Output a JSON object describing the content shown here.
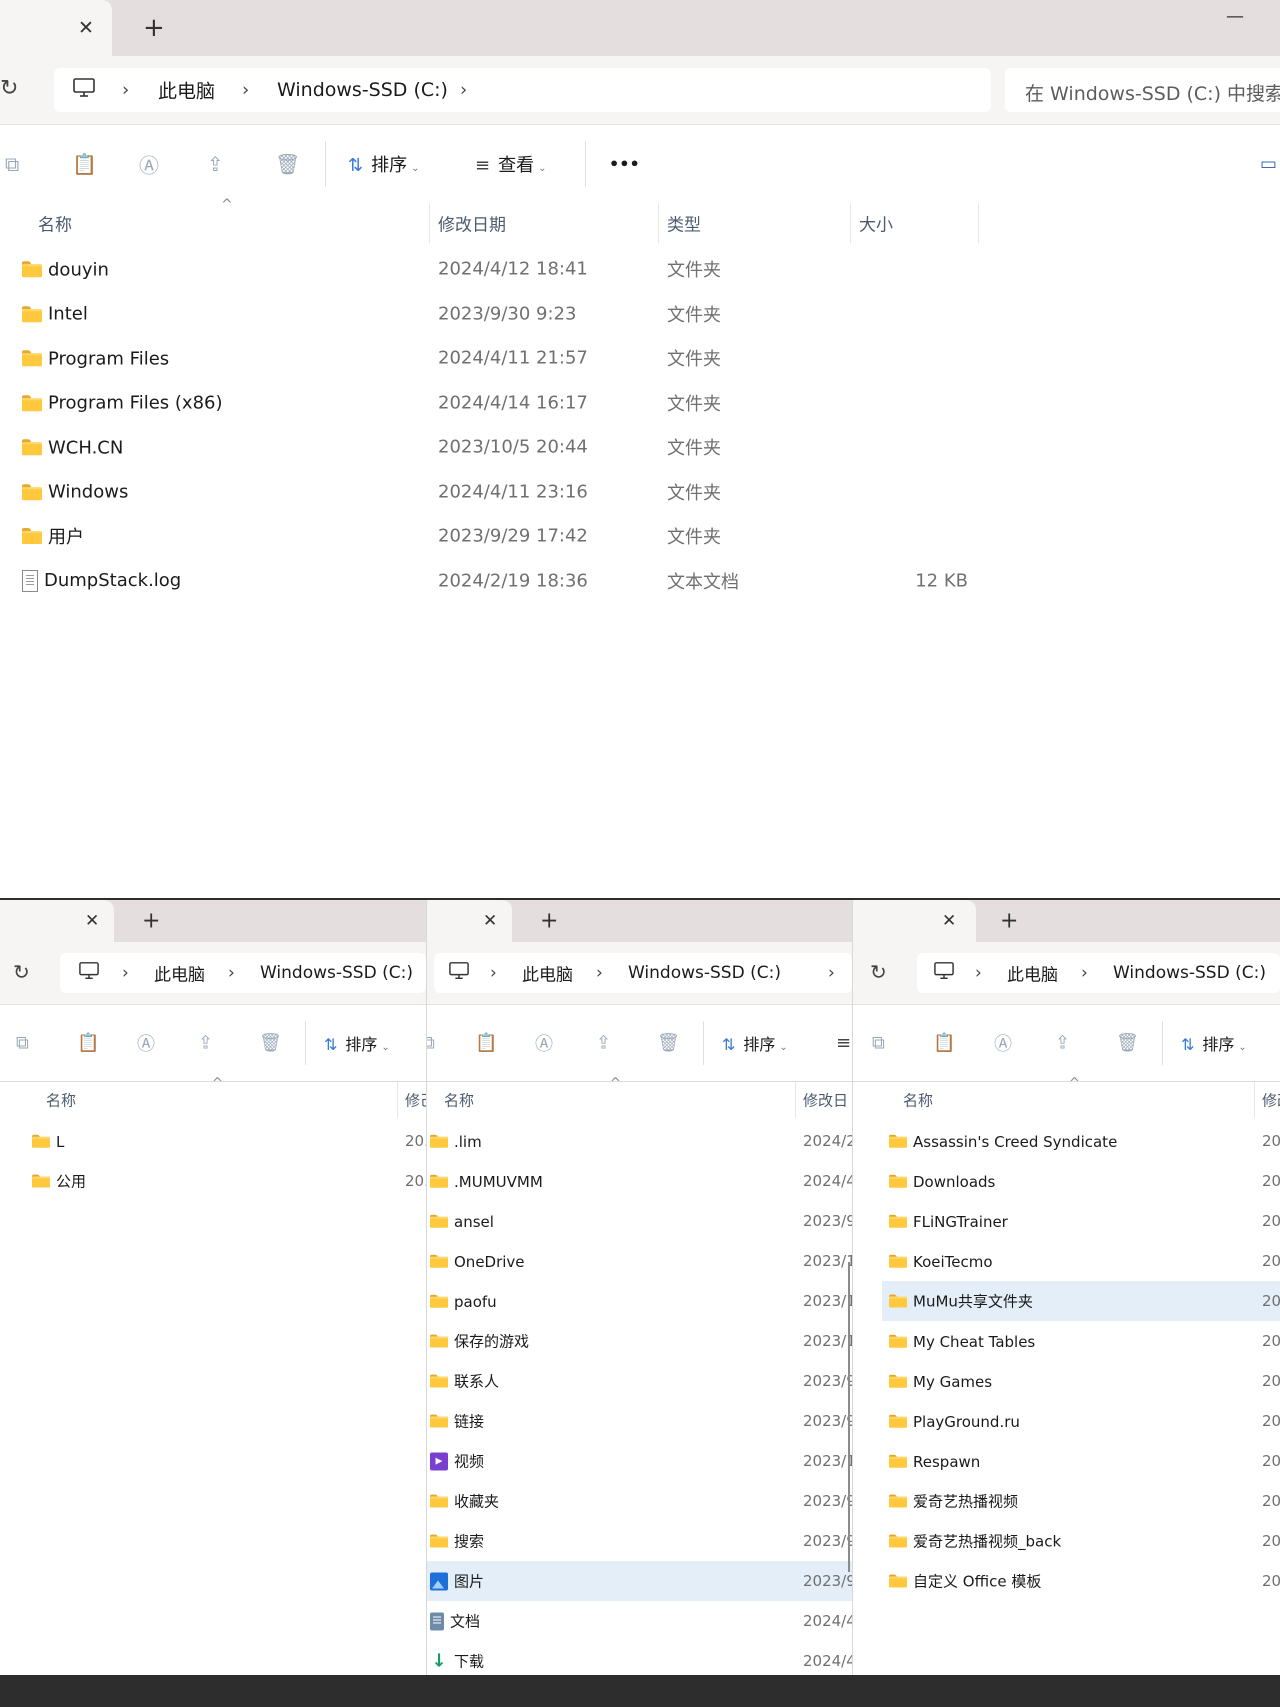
{
  "main": {
    "tab_close": "✕",
    "tab_new": "+",
    "minimize": "—",
    "breadcrumb": [
      "此电脑",
      "Windows-SSD (C:)"
    ],
    "search_placeholder": "在 Windows-SSD (C:) 中搜索",
    "toolbar": {
      "sort": "排序",
      "view": "查看",
      "more": "•••"
    },
    "columns": {
      "name": "名称",
      "modified": "修改日期",
      "type": "类型",
      "size": "大小"
    },
    "rows": [
      {
        "name": "douyin",
        "date": "2024/4/12 18:41",
        "type": "文件夹",
        "size": "",
        "icon": "folder"
      },
      {
        "name": "Intel",
        "date": "2023/9/30 9:23",
        "type": "文件夹",
        "size": "",
        "icon": "folder"
      },
      {
        "name": "Program Files",
        "date": "2024/4/11 21:57",
        "type": "文件夹",
        "size": "",
        "icon": "folder"
      },
      {
        "name": "Program Files (x86)",
        "date": "2024/4/14 16:17",
        "type": "文件夹",
        "size": "",
        "icon": "folder"
      },
      {
        "name": "WCH.CN",
        "date": "2023/10/5 20:44",
        "type": "文件夹",
        "size": "",
        "icon": "folder"
      },
      {
        "name": "Windows",
        "date": "2024/4/11 23:16",
        "type": "文件夹",
        "size": "",
        "icon": "folder"
      },
      {
        "name": "用户",
        "date": "2023/9/29 17:42",
        "type": "文件夹",
        "size": "",
        "icon": "folder"
      },
      {
        "name": "DumpStack.log",
        "date": "2024/2/19 18:36",
        "type": "文本文档",
        "size": "12 KB",
        "icon": "file"
      }
    ]
  },
  "pane1": {
    "tab_close": "✕",
    "tab_new": "+",
    "breadcrumb": [
      "此电脑",
      "Windows-SSD (C:)"
    ],
    "sort": "排序",
    "col_name": "名称",
    "col_modified": "修己",
    "rows": [
      {
        "name": "L",
        "date": "20.",
        "icon": "folder"
      },
      {
        "name": "公用",
        "date": "20.",
        "icon": "folder"
      }
    ]
  },
  "pane2": {
    "tab_close": "✕",
    "tab_new": "+",
    "breadcrumb": [
      "此电脑",
      "Windows-SSD (C:)"
    ],
    "sort": "排序",
    "col_name": "名称",
    "col_modified": "修改日",
    "rows": [
      {
        "name": ".lim",
        "date": "2024/2",
        "icon": "folder"
      },
      {
        "name": ".MUMUVMM",
        "date": "2024/4",
        "icon": "folder"
      },
      {
        "name": "ansel",
        "date": "2023/9",
        "icon": "folder"
      },
      {
        "name": "OneDrive",
        "date": "2023/1",
        "icon": "folder"
      },
      {
        "name": "paofu",
        "date": "2023/1",
        "icon": "folder"
      },
      {
        "name": "保存的游戏",
        "date": "2023/1",
        "icon": "folder"
      },
      {
        "name": "联系人",
        "date": "2023/9",
        "icon": "folder"
      },
      {
        "name": "链接",
        "date": "2023/9",
        "icon": "folder"
      },
      {
        "name": "视频",
        "date": "2023/1",
        "icon": "video"
      },
      {
        "name": "收藏夹",
        "date": "2023/9",
        "icon": "folder"
      },
      {
        "name": "搜索",
        "date": "2023/9",
        "icon": "folder"
      },
      {
        "name": "图片",
        "date": "2023/9",
        "icon": "picture",
        "selected": true
      },
      {
        "name": "文档",
        "date": "2024/4",
        "icon": "document"
      },
      {
        "name": "下载",
        "date": "2024/4",
        "icon": "download"
      }
    ]
  },
  "pane3": {
    "tab_close": "✕",
    "tab_new": "+",
    "breadcrumb": [
      "此电脑",
      "Windows-SSD (C:)"
    ],
    "sort": "排序",
    "col_name": "名称",
    "col_modified": "修改",
    "rows": [
      {
        "name": "Assassin's Creed Syndicate",
        "date": "20",
        "icon": "folder"
      },
      {
        "name": "Downloads",
        "date": "20",
        "icon": "folder"
      },
      {
        "name": "FLiNGTrainer",
        "date": "20",
        "icon": "folder"
      },
      {
        "name": "KoeiTecmo",
        "date": "20",
        "icon": "folder"
      },
      {
        "name": "MuMu共享文件夹",
        "date": "20",
        "icon": "folder",
        "selected": true
      },
      {
        "name": "My Cheat Tables",
        "date": "20",
        "icon": "folder"
      },
      {
        "name": "My Games",
        "date": "20",
        "icon": "folder"
      },
      {
        "name": "PlayGround.ru",
        "date": "20",
        "icon": "folder"
      },
      {
        "name": "Respawn",
        "date": "20",
        "icon": "folder"
      },
      {
        "name": "爱奇艺热播视频",
        "date": "20",
        "icon": "folder"
      },
      {
        "name": "爱奇艺热播视频_back",
        "date": "20",
        "icon": "folder"
      },
      {
        "name": "自定义 Office 模板",
        "date": "20",
        "icon": "folder"
      }
    ]
  }
}
